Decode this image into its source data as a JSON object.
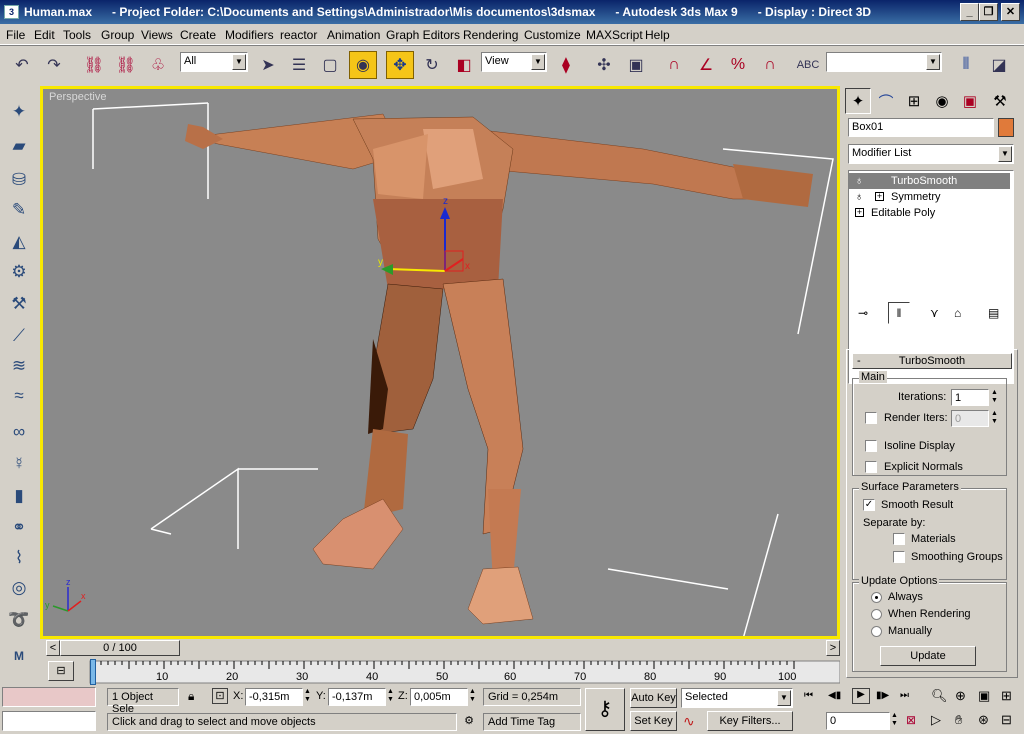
{
  "titlebar": {
    "text": "Human.max      - Project Folder: C:\\Documents and Settings\\Administrador\\Mis documentos\\3dsmax      - Autodesk 3ds Max 9      - Display : Direct 3D",
    "minimize": "_",
    "maximize": "❐",
    "close": "✕"
  },
  "menu": [
    "File",
    "Edit",
    "Tools",
    "Group",
    "Views",
    "Create",
    "Modifiers",
    "reactor",
    "Animation",
    "Graph Editors",
    "Rendering",
    "Customize",
    "MAXScript",
    "Help"
  ],
  "toolbar": {
    "selection_filter": "All",
    "ref_coord": "View",
    "named_selection": ""
  },
  "viewport": {
    "label": "Perspective",
    "gizmo_x": "x",
    "gizmo_y": "y",
    "gizmo_z": "z",
    "axis_x": "x",
    "axis_y": "y",
    "axis_z": "z"
  },
  "command_panel": {
    "object_name": "Box01",
    "object_color": "#e07a3a",
    "modifier_list": "Modifier List",
    "stack": [
      {
        "label": "TurboSmooth",
        "selected": true
      },
      {
        "label": "Symmetry",
        "selected": false
      },
      {
        "label": "Editable Poly",
        "selected": false
      }
    ],
    "rollout_title": "TurboSmooth",
    "rollout_toggle": "-",
    "main": {
      "title": "Main",
      "iterations_label": "Iterations:",
      "iterations_value": "1",
      "render_iters_label": "Render Iters:",
      "render_iters_value": "0",
      "isoline_display": "Isoline Display",
      "explicit_normals": "Explicit Normals"
    },
    "surface": {
      "title": "Surface Parameters",
      "smooth_result": "Smooth Result",
      "separate_by": "Separate by:",
      "materials": "Materials",
      "smoothing_groups": "Smoothing Groups"
    },
    "update": {
      "title": "Update Options",
      "always": "Always",
      "when_rendering": "When Rendering",
      "manually": "Manually",
      "update_button": "Update"
    }
  },
  "timeline": {
    "frame_display": "0 / 100",
    "ticks": [
      "0",
      "10",
      "20",
      "30",
      "40",
      "50",
      "60",
      "70",
      "80",
      "90",
      "100"
    ]
  },
  "status": {
    "selection_count": "1 Object Sele",
    "x_label": "X:",
    "x_value": "-0,315m",
    "y_label": "Y:",
    "y_value": "-0,137m",
    "z_label": "Z:",
    "z_value": "0,005m",
    "grid": "Grid = 0,254m",
    "prompt": "Click and drag to select and move objects",
    "add_time_tag": "Add Time Tag",
    "auto_key": "Auto Key",
    "set_key": "Set Key",
    "key_mode": "Selected",
    "key_filters": "Key Filters...",
    "current_frame": "0"
  }
}
